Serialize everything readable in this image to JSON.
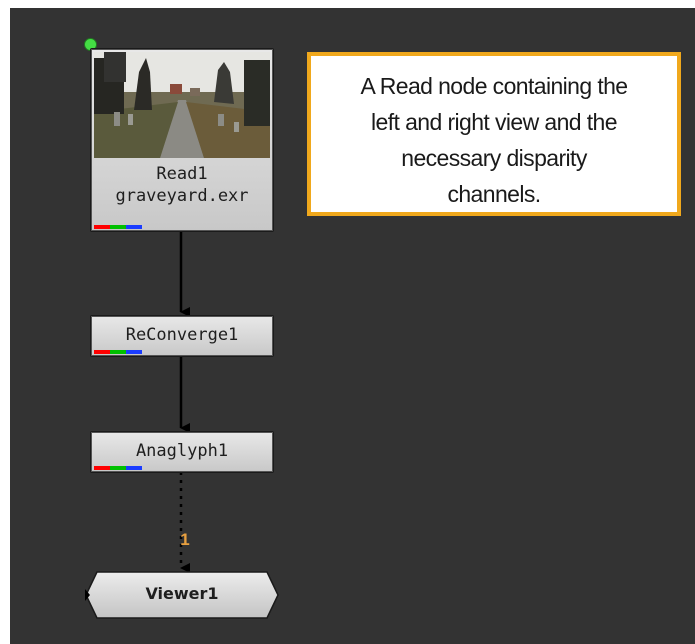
{
  "nodes": {
    "read": {
      "name": "Read1",
      "file": "graveyard.exr",
      "thumbnail_icon": "graveyard-path-thumbnail"
    },
    "reconverge": {
      "name": "ReConverge1"
    },
    "anaglyph": {
      "name": "Anaglyph1"
    },
    "viewer": {
      "name": "Viewer1",
      "input_label": "1"
    }
  },
  "sticky_note": {
    "lines": [
      "A Read node containing the",
      "left and right view and the",
      "necessary disparity",
      "channels."
    ]
  },
  "colors": {
    "canvas_bg": "#333333",
    "sticky_border": "#f0a81c",
    "pipe": "#000000",
    "channel_red": "#ff0000",
    "channel_green": "#00c000",
    "channel_blue": "#1a3cff",
    "output_dot": "#44dd44"
  }
}
